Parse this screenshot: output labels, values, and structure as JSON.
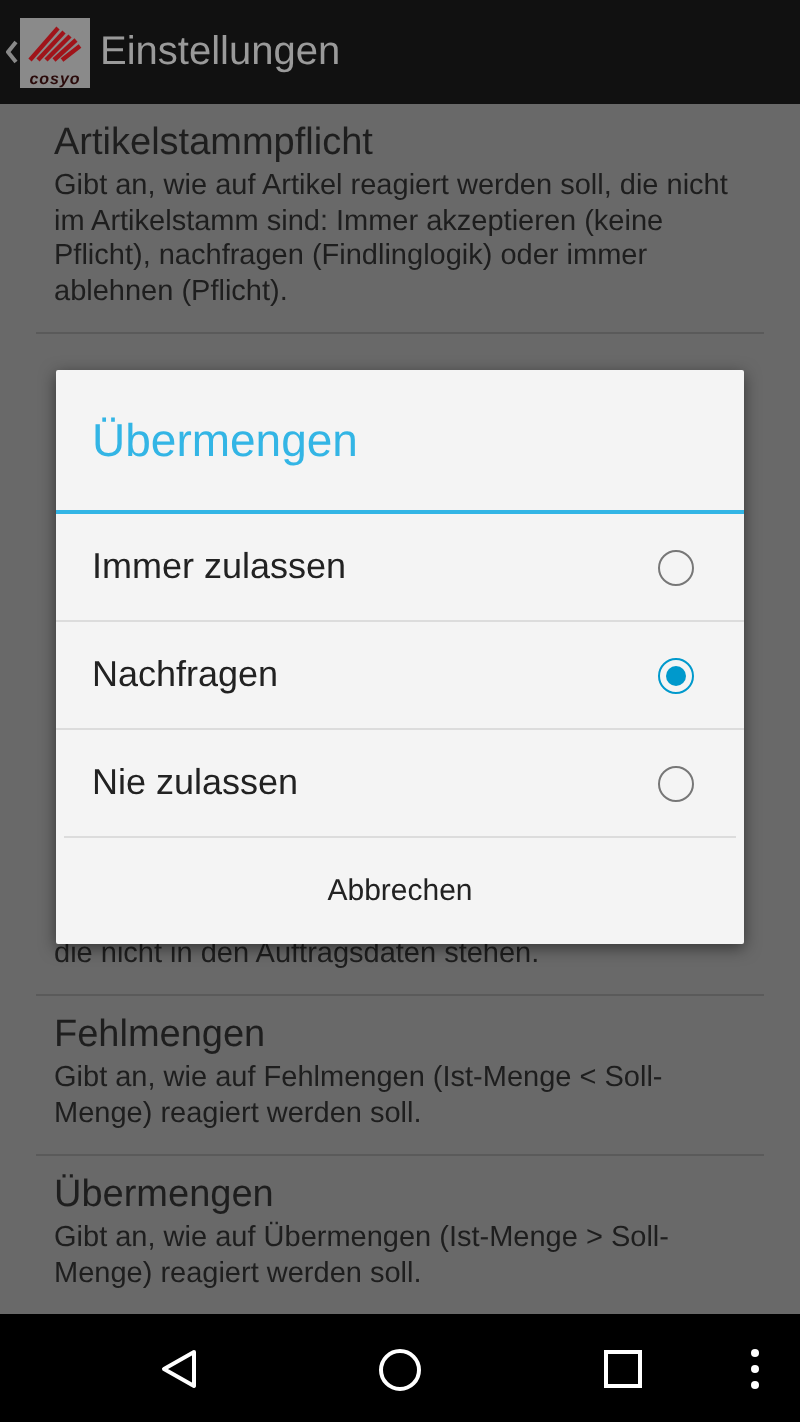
{
  "action_bar": {
    "logo_text": "cosyo",
    "title": "Einstellungen"
  },
  "preferences": [
    {
      "title": "Artikelstammpflicht",
      "summary": "Gibt an, wie auf Artikel reagiert werden soll, die nicht im Artikelstamm sind: Immer akzeptieren (keine Pflicht), nachfragen (Findlinglogik) oder immer ablehnen (Pflicht)."
    },
    {
      "summary": "die nicht in den Auftragsdaten stehen."
    },
    {
      "title": "Fehlmengen",
      "summary": "Gibt an, wie auf Fehlmengen (Ist-Menge < Soll-Menge) reagiert werden soll."
    },
    {
      "title": "Übermengen",
      "summary": "Gibt an, wie auf Übermengen (Ist-Menge > Soll-Menge) reagiert werden soll."
    }
  ],
  "dialog": {
    "title": "Übermengen",
    "options": [
      {
        "label": "Immer zulassen",
        "selected": false
      },
      {
        "label": "Nachfragen",
        "selected": true
      },
      {
        "label": "Nie zulassen",
        "selected": false
      }
    ],
    "cancel": "Abbrechen"
  }
}
